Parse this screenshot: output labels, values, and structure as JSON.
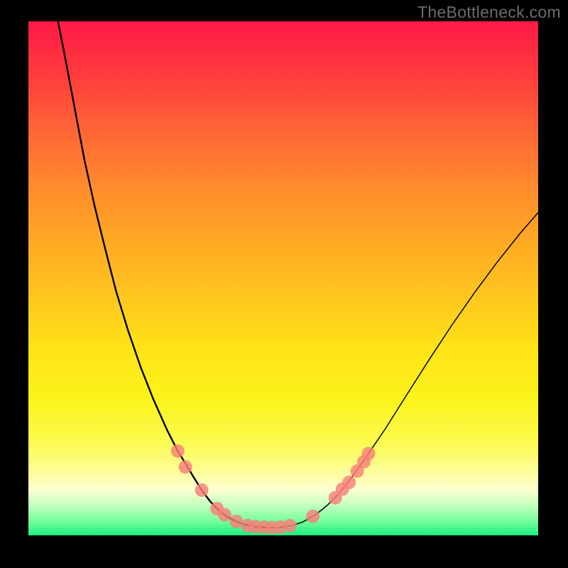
{
  "watermark": "TheBottleneck.com",
  "chart_data": {
    "type": "line",
    "title": "",
    "xlabel": "",
    "ylabel": "",
    "xlim": [
      0,
      1
    ],
    "ylim": [
      0,
      1
    ],
    "curve": [
      [
        0.058,
        0.0
      ],
      [
        0.07,
        0.06
      ],
      [
        0.09,
        0.165
      ],
      [
        0.11,
        0.27
      ],
      [
        0.13,
        0.36
      ],
      [
        0.15,
        0.44
      ],
      [
        0.172,
        0.525
      ],
      [
        0.195,
        0.6
      ],
      [
        0.22,
        0.672
      ],
      [
        0.245,
        0.735
      ],
      [
        0.272,
        0.795
      ],
      [
        0.293,
        0.836
      ],
      [
        0.308,
        0.86
      ],
      [
        0.323,
        0.885
      ],
      [
        0.34,
        0.912
      ],
      [
        0.355,
        0.932
      ],
      [
        0.37,
        0.948
      ],
      [
        0.387,
        0.962
      ],
      [
        0.405,
        0.972
      ],
      [
        0.425,
        0.979
      ],
      [
        0.45,
        0.984
      ],
      [
        0.475,
        0.985
      ],
      [
        0.5,
        0.984
      ],
      [
        0.52,
        0.98
      ],
      [
        0.538,
        0.974
      ],
      [
        0.555,
        0.965
      ],
      [
        0.572,
        0.953
      ],
      [
        0.588,
        0.94
      ],
      [
        0.603,
        0.925
      ],
      [
        0.616,
        0.91
      ],
      [
        0.63,
        0.893
      ],
      [
        0.645,
        0.872
      ],
      [
        0.66,
        0.852
      ],
      [
        0.667,
        0.841
      ],
      [
        0.7,
        0.793
      ],
      [
        0.74,
        0.73
      ],
      [
        0.785,
        0.66
      ],
      [
        0.83,
        0.592
      ],
      [
        0.875,
        0.528
      ],
      [
        0.92,
        0.468
      ],
      [
        0.965,
        0.412
      ],
      [
        1.0,
        0.372
      ]
    ],
    "markers_left": [
      [
        0.293,
        0.836
      ],
      [
        0.308,
        0.867
      ],
      [
        0.34,
        0.912
      ],
      [
        0.37,
        0.948
      ],
      [
        0.385,
        0.96
      ],
      [
        0.408,
        0.973
      ]
    ],
    "markers_bottom": [
      [
        0.43,
        0.981
      ],
      [
        0.445,
        0.983
      ],
      [
        0.462,
        0.984
      ],
      [
        0.478,
        0.985
      ],
      [
        0.495,
        0.984
      ],
      [
        0.513,
        0.981
      ]
    ],
    "markers_right": [
      [
        0.558,
        0.963
      ],
      [
        0.602,
        0.927
      ],
      [
        0.616,
        0.91
      ],
      [
        0.629,
        0.897
      ],
      [
        0.645,
        0.875
      ],
      [
        0.658,
        0.857
      ],
      [
        0.667,
        0.841
      ]
    ],
    "marker_radius": 9.5,
    "marker_color": "#f97f79"
  }
}
